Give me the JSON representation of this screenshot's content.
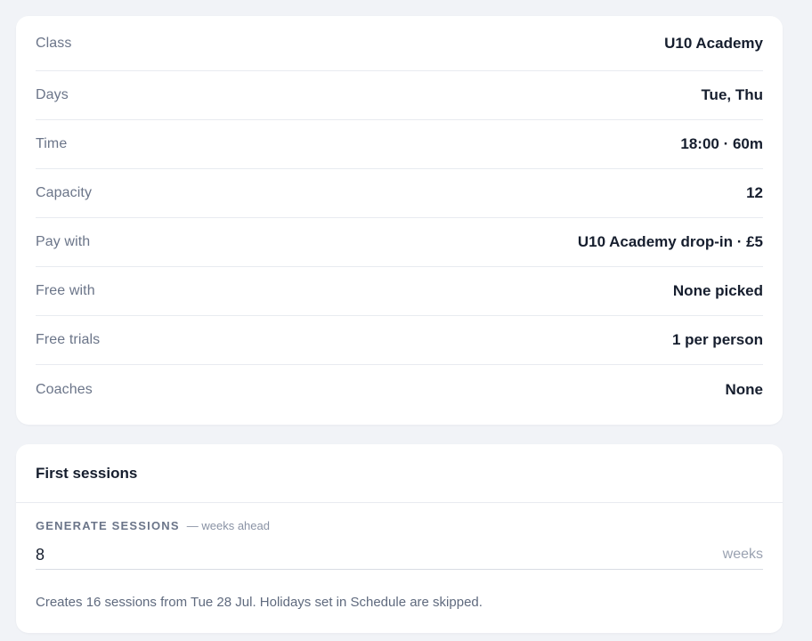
{
  "summary": {
    "rows": [
      {
        "label": "Class",
        "value": "U10 Academy"
      },
      {
        "label": "Days",
        "value": "Tue, Thu"
      },
      {
        "label": "Time",
        "value": "18:00 · 60m"
      },
      {
        "label": "Capacity",
        "value": "12"
      },
      {
        "label": "Pay with",
        "value": "U10 Academy drop-in · £5"
      },
      {
        "label": "Free with",
        "value": "None picked"
      },
      {
        "label": "Free trials",
        "value": "1 per person"
      },
      {
        "label": "Coaches",
        "value": "None"
      }
    ]
  },
  "sessions": {
    "title": "First sessions",
    "field_label": "GENERATE SESSIONS",
    "field_hint": "— weeks ahead",
    "weeks_value": "8",
    "unit": "weeks",
    "note": "Creates 16 sessions from Tue 28 Jul. Holidays set in Schedule are skipped."
  }
}
